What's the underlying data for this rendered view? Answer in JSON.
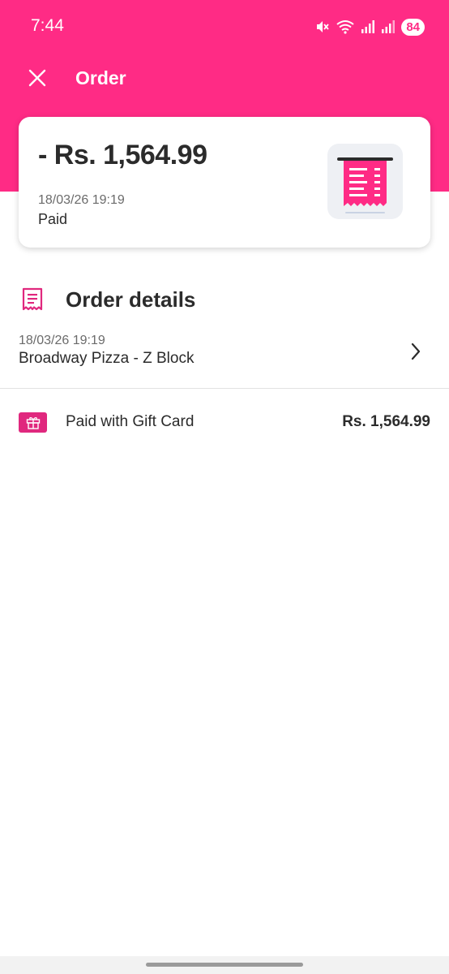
{
  "status_bar": {
    "time": "7:44",
    "battery": "84",
    "icons": [
      "mute-icon",
      "wifi-icon",
      "signal-icon",
      "signal-icon-2"
    ]
  },
  "header": {
    "title": "Order",
    "close_icon": "close-icon",
    "background_color": "#ff2b85"
  },
  "summary": {
    "amount": "- Rs. 1,564.99",
    "date": "18/03/26 19:19",
    "status": "Paid",
    "icon": "receipt-icon"
  },
  "order_details": {
    "title": "Order details",
    "icon": "receipt-outline-icon",
    "date": "18/03/26 19:19",
    "restaurant": "Broadway Pizza - Z Block"
  },
  "payment": {
    "label": "Paid with Gift Card",
    "amount": "Rs. 1,564.99",
    "icon": "gift-icon"
  },
  "colors": {
    "accent": "#ff2b85",
    "text": "#2b2b2b",
    "muted": "#6b6b6b"
  }
}
